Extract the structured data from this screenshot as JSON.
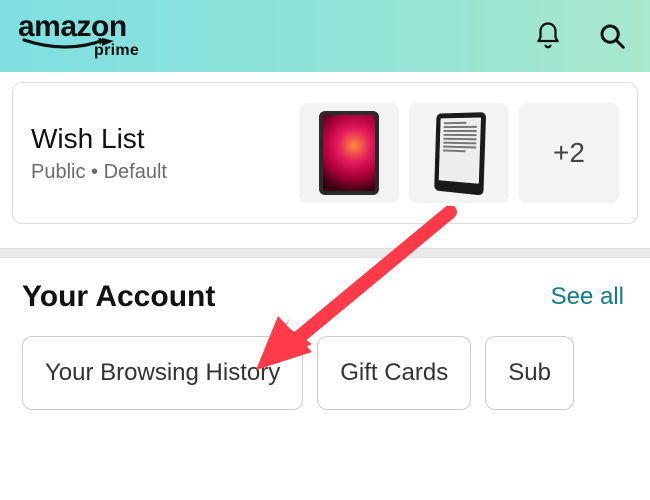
{
  "brand": {
    "name": "amazon",
    "sub": "prime"
  },
  "wishlist": {
    "title": "Wish List",
    "visibility": "Public",
    "status": "Default",
    "more_count_label": "+2"
  },
  "account": {
    "title": "Your Account",
    "see_all": "See all",
    "chips": [
      {
        "label": "Your Browsing History"
      },
      {
        "label": "Gift Cards"
      },
      {
        "label": "Sub"
      }
    ]
  },
  "icons": {
    "bell": "notifications-icon",
    "search": "search-icon"
  },
  "colors": {
    "link": "#0f7c88",
    "arrow": "#ff3b4a"
  }
}
